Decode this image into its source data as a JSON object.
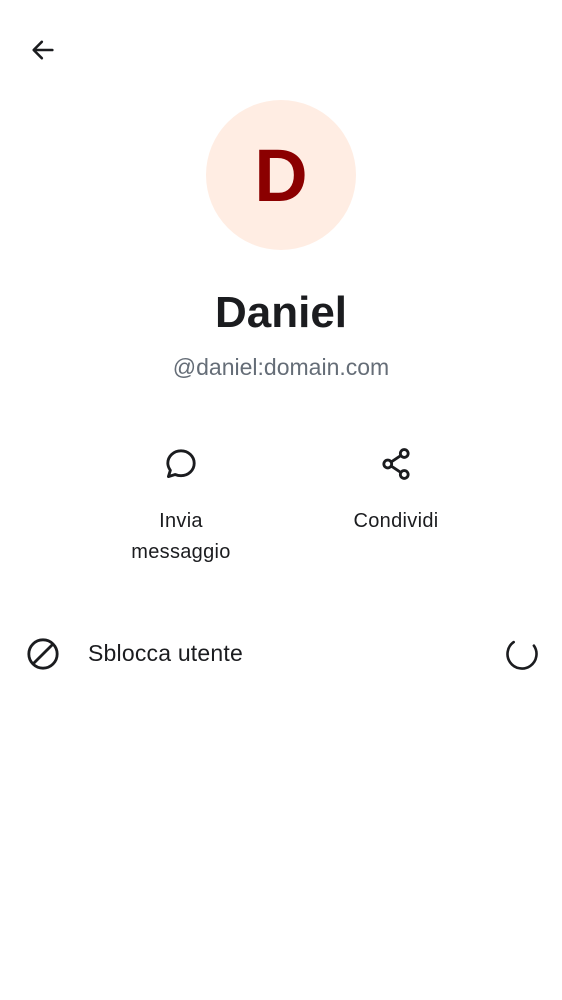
{
  "header": {
    "back_icon": "arrow-left-icon"
  },
  "profile": {
    "avatar_letter": "D",
    "avatar_bg": "#ffede3",
    "avatar_fg": "#8b0000",
    "display_name": "Daniel",
    "user_id": "@daniel:domain.com"
  },
  "actions": [
    {
      "icon": "chat-bubble-icon",
      "label_line1": "Invia",
      "label_line2": "messaggio"
    },
    {
      "icon": "share-icon",
      "label_line1": "Condividi",
      "label_line2": ""
    }
  ],
  "unblock_row": {
    "icon": "block-icon",
    "label": "Sblocca utente",
    "status_icon": "loading-spinner-icon"
  }
}
